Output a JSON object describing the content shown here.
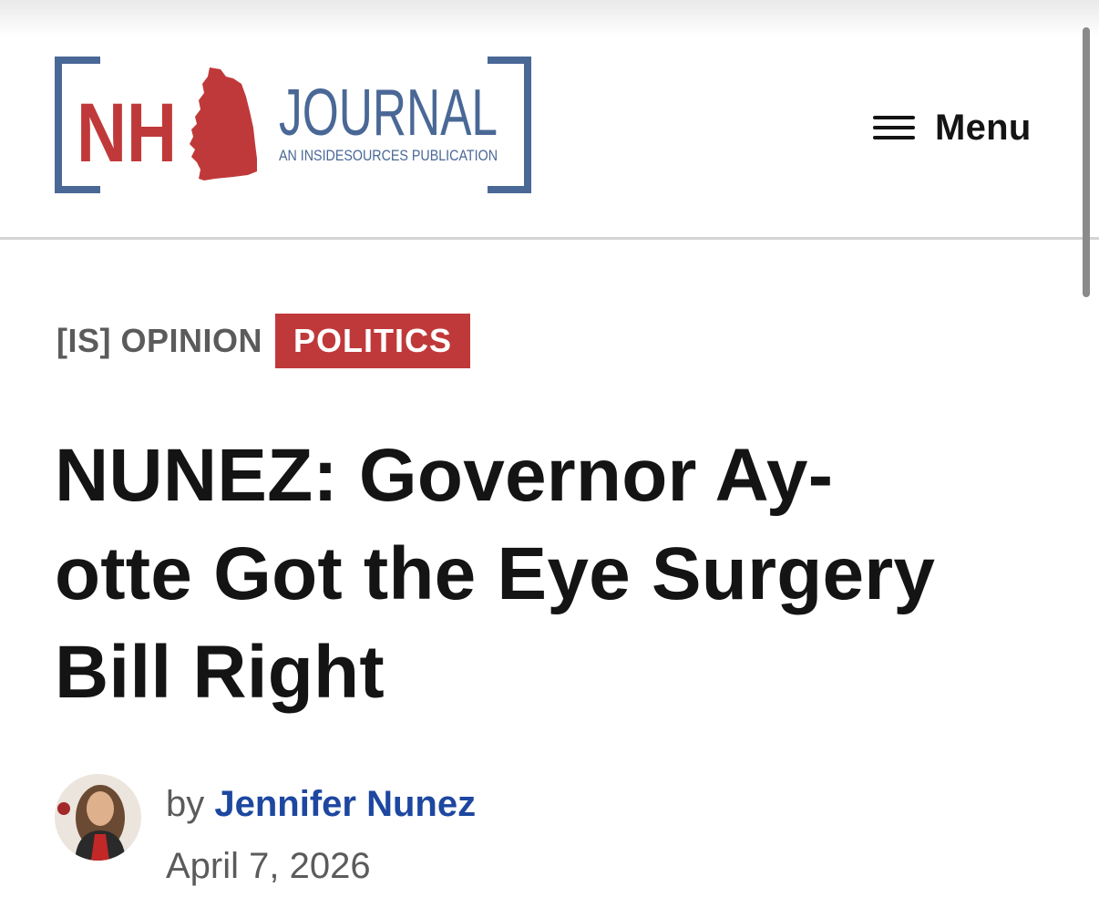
{
  "header": {
    "logo": {
      "text_nh": "NH",
      "text_journal": "JOURNAL",
      "tagline": "AN INSIDESOURCES PUBLICATION"
    },
    "menu_label": "Menu"
  },
  "article": {
    "tags": {
      "section": "[IS] OPINION",
      "category": "POLITICS"
    },
    "headline": "NUNEZ: Governor Ay-otte Got the Eye Surgery Bill Right",
    "byline": {
      "prefix": "by",
      "author": "Jennifer Nunez",
      "date": "April 7, 2026"
    }
  },
  "colors": {
    "brand_red": "#c0393a",
    "brand_blue": "#4a6896",
    "author_link": "#1d47a0"
  }
}
